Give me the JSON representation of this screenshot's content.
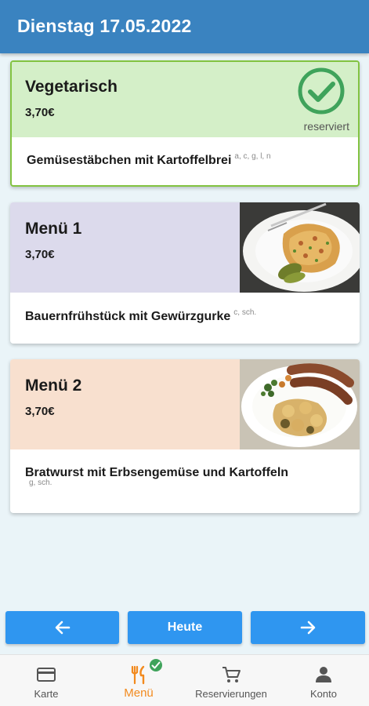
{
  "header": {
    "title": "Dienstag 17.05.2022"
  },
  "colors": {
    "appbar": "#3a83c0",
    "button": "#2f96f0",
    "active_tab": "#f28a1e",
    "reserved_check": "#3fa35b"
  },
  "meals": [
    {
      "title": "Vegetarisch",
      "price": "3,70€",
      "description": "Gemüsestäbchen mit Kartoffelbrei",
      "allergens": "a, c, g, l, n",
      "status": "reserviert",
      "header_color": "#d4efc8"
    },
    {
      "title": "Menü 1",
      "price": "3,70€",
      "description": "Bauernfrühstück mit Gewürzgurke",
      "allergens": "c, sch.",
      "header_color": "#dcdaec"
    },
    {
      "title": "Menü 2",
      "price": "3,70€",
      "description": "Bratwurst mit Erbsengemüse und Kartoffeln",
      "allergens": "g, sch.",
      "header_color": "#f8e0cf"
    }
  ],
  "buttons": {
    "prev_icon": "arrow-left-icon",
    "today": "Heute",
    "next_icon": "arrow-right-icon"
  },
  "bottom_nav": [
    {
      "label": "Karte",
      "icon": "card-icon"
    },
    {
      "label": "Menü",
      "icon": "cutlery-icon",
      "active": true
    },
    {
      "label": "Reservierungen",
      "icon": "cart-icon"
    },
    {
      "label": "Konto",
      "icon": "person-icon"
    }
  ]
}
